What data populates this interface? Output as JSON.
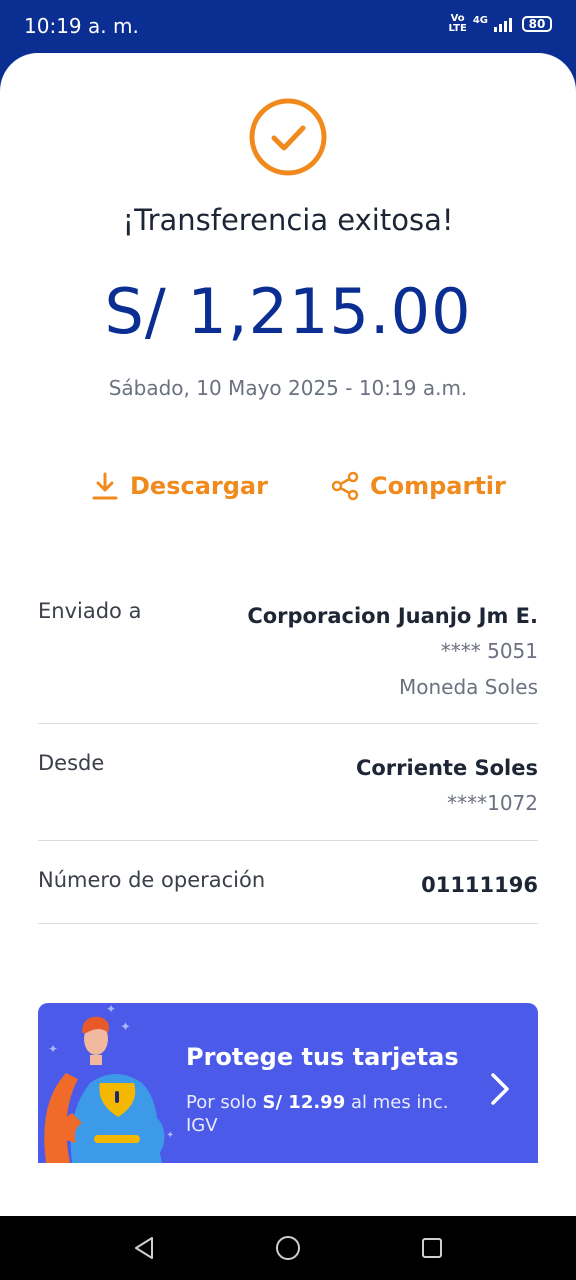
{
  "status_bar": {
    "time": "10:19 a. m.",
    "volte": "Vo\nLTE",
    "network": "4G",
    "battery": "80"
  },
  "receipt": {
    "title": "¡Transferencia exitosa!",
    "amount": "S/ 1,215.00",
    "datetime": "Sábado, 10 Mayo 2025 - 10:19 a.m.",
    "download_label": "Descargar",
    "share_label": "Compartir",
    "accent_color": "#f08a1c",
    "brand_color": "#0a2e91"
  },
  "details": {
    "sent_to": {
      "label": "Enviado a",
      "name": "Corporacion Juanjo Jm E.",
      "account": "**** 5051",
      "currency": "Moneda Soles"
    },
    "from": {
      "label": "Desde",
      "account_name": "Corriente Soles",
      "account": "****1072"
    },
    "operation": {
      "label": "Número de operación",
      "number": "01111196"
    }
  },
  "promo": {
    "title": "Protege tus tarjetas",
    "text_prefix": "Por solo ",
    "price": "S/ 12.99",
    "text_suffix": " al mes inc. IGV",
    "background": "#4b5ae8"
  }
}
